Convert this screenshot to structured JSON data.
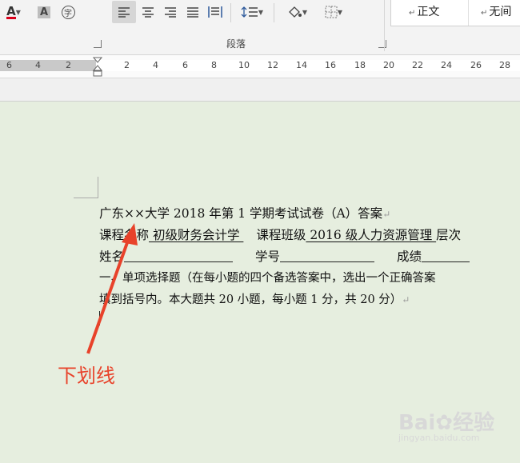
{
  "ribbon": {
    "paragraph_group_label": "段落",
    "styles": [
      {
        "label": "正文"
      },
      {
        "label": "无间"
      }
    ],
    "accent_colors": {
      "font_color_bar": "#d9001b"
    }
  },
  "ruler": {
    "numbers_left": [
      "6",
      "4",
      "2"
    ],
    "numbers_right": [
      "2",
      "4",
      "6",
      "8",
      "10",
      "12",
      "14",
      "16",
      "18",
      "20",
      "22",
      "24",
      "26",
      "28"
    ]
  },
  "document": {
    "line1": "广东××大学 2018 年第 1 学期考试试卷（A）答案",
    "line2_label": "课程名称",
    "line2_course": " 初级财务会计学 ",
    "line2_class_label": "课程班级",
    "line2_class": " 2016 级人力资源管理 ",
    "line2_tail": "层次",
    "line3_name": "姓名",
    "line3_id": "学号",
    "line3_score": "成绩",
    "line4": "一、单项选择题（在每小题的四个备选答案中，选出一个正确答案",
    "line5": "填到括号内。本大题共 20 小题，每小题 1 分，共 20 分）",
    "paragraph_mark": "↵"
  },
  "annotation": {
    "text": "下划线",
    "color": "#e8422a"
  },
  "watermark": {
    "brand": "Bai",
    "suffix": "经验",
    "url": "jingyan.baidu.com"
  }
}
